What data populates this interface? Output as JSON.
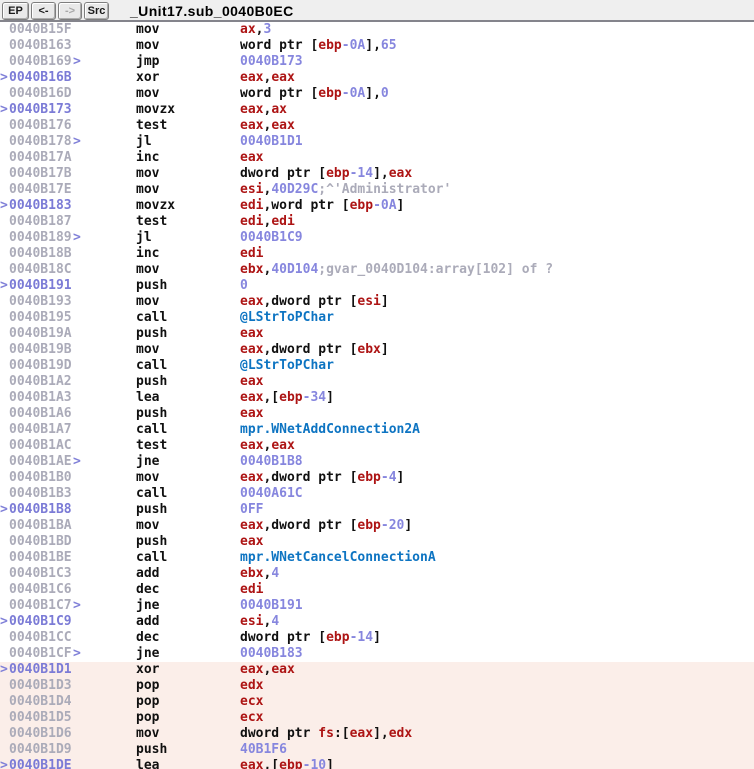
{
  "toolbar": {
    "buttons": [
      {
        "label": "EP",
        "enabled": true
      },
      {
        "label": "<-",
        "enabled": true
      },
      {
        "label": "->",
        "enabled": false
      },
      {
        "label": "Src",
        "enabled": true
      }
    ],
    "title": "_Unit17.sub_0040B0EC"
  },
  "colors": {
    "register": "#AD1414",
    "number": "#8686DE",
    "call_target": "#0D74C2",
    "plain_text": "#101010",
    "address_plain": "#ABABB9",
    "address_jump_target": "#7B7BD6",
    "comment": "#ABABB9",
    "highlight_background": "#FBEEE9",
    "toolbar_background": "#EFEFEF",
    "separator": "#84848C"
  },
  "disassembly": {
    "rows": [
      {
        "pre": "",
        "addr": "0040B15F",
        "addr_type": "plain",
        "suf": "",
        "mnemonic": "mov",
        "highlight": false,
        "operands": [
          {
            "t": "reg",
            "v": "ax"
          },
          {
            "t": "plain",
            "v": ","
          },
          {
            "t": "num",
            "v": "3"
          }
        ]
      },
      {
        "pre": "",
        "addr": "0040B163",
        "addr_type": "plain",
        "suf": "",
        "mnemonic": "mov",
        "highlight": false,
        "operands": [
          {
            "t": "plain",
            "v": "word ptr ["
          },
          {
            "t": "reg",
            "v": "ebp"
          },
          {
            "t": "num",
            "v": "-0A"
          },
          {
            "t": "plain",
            "v": "],"
          },
          {
            "t": "num",
            "v": "65"
          }
        ]
      },
      {
        "pre": "",
        "addr": "0040B169",
        "addr_type": "plain",
        "suf": ">",
        "mnemonic": "jmp",
        "highlight": false,
        "operands": [
          {
            "t": "num",
            "v": "0040B173"
          }
        ]
      },
      {
        "pre": ">",
        "addr": "0040B16B",
        "addr_type": "target",
        "suf": "",
        "mnemonic": "xor",
        "highlight": false,
        "operands": [
          {
            "t": "reg",
            "v": "eax"
          },
          {
            "t": "plain",
            "v": ","
          },
          {
            "t": "reg",
            "v": "eax"
          }
        ]
      },
      {
        "pre": "",
        "addr": "0040B16D",
        "addr_type": "plain",
        "suf": "",
        "mnemonic": "mov",
        "highlight": false,
        "operands": [
          {
            "t": "plain",
            "v": "word ptr ["
          },
          {
            "t": "reg",
            "v": "ebp"
          },
          {
            "t": "num",
            "v": "-0A"
          },
          {
            "t": "plain",
            "v": "],"
          },
          {
            "t": "num",
            "v": "0"
          }
        ]
      },
      {
        "pre": ">",
        "addr": "0040B173",
        "addr_type": "target",
        "suf": "",
        "mnemonic": "movzx",
        "highlight": false,
        "operands": [
          {
            "t": "reg",
            "v": "eax"
          },
          {
            "t": "plain",
            "v": ","
          },
          {
            "t": "reg",
            "v": "ax"
          }
        ]
      },
      {
        "pre": "",
        "addr": "0040B176",
        "addr_type": "plain",
        "suf": "",
        "mnemonic": "test",
        "highlight": false,
        "operands": [
          {
            "t": "reg",
            "v": "eax"
          },
          {
            "t": "plain",
            "v": ","
          },
          {
            "t": "reg",
            "v": "eax"
          }
        ]
      },
      {
        "pre": "",
        "addr": "0040B178",
        "addr_type": "plain",
        "suf": ">",
        "mnemonic": "jl",
        "highlight": false,
        "operands": [
          {
            "t": "num",
            "v": "0040B1D1"
          }
        ]
      },
      {
        "pre": "",
        "addr": "0040B17A",
        "addr_type": "plain",
        "suf": "",
        "mnemonic": "inc",
        "highlight": false,
        "operands": [
          {
            "t": "reg",
            "v": "eax"
          }
        ]
      },
      {
        "pre": "",
        "addr": "0040B17B",
        "addr_type": "plain",
        "suf": "",
        "mnemonic": "mov",
        "highlight": false,
        "operands": [
          {
            "t": "plain",
            "v": "dword ptr ["
          },
          {
            "t": "reg",
            "v": "ebp"
          },
          {
            "t": "num",
            "v": "-14"
          },
          {
            "t": "plain",
            "v": "],"
          },
          {
            "t": "reg",
            "v": "eax"
          }
        ]
      },
      {
        "pre": "",
        "addr": "0040B17E",
        "addr_type": "plain",
        "suf": "",
        "mnemonic": "mov",
        "highlight": false,
        "operands": [
          {
            "t": "reg",
            "v": "esi"
          },
          {
            "t": "plain",
            "v": ","
          },
          {
            "t": "num",
            "v": "40D29C"
          },
          {
            "t": "comment",
            "v": ";^'Administrator'"
          }
        ]
      },
      {
        "pre": ">",
        "addr": "0040B183",
        "addr_type": "target",
        "suf": "",
        "mnemonic": "movzx",
        "highlight": false,
        "operands": [
          {
            "t": "reg",
            "v": "edi"
          },
          {
            "t": "plain",
            "v": ",word ptr ["
          },
          {
            "t": "reg",
            "v": "ebp"
          },
          {
            "t": "num",
            "v": "-0A"
          },
          {
            "t": "plain",
            "v": "]"
          }
        ]
      },
      {
        "pre": "",
        "addr": "0040B187",
        "addr_type": "plain",
        "suf": "",
        "mnemonic": "test",
        "highlight": false,
        "operands": [
          {
            "t": "reg",
            "v": "edi"
          },
          {
            "t": "plain",
            "v": ","
          },
          {
            "t": "reg",
            "v": "edi"
          }
        ]
      },
      {
        "pre": "",
        "addr": "0040B189",
        "addr_type": "plain",
        "suf": ">",
        "mnemonic": "jl",
        "highlight": false,
        "operands": [
          {
            "t": "num",
            "v": "0040B1C9"
          }
        ]
      },
      {
        "pre": "",
        "addr": "0040B18B",
        "addr_type": "plain",
        "suf": "",
        "mnemonic": "inc",
        "highlight": false,
        "operands": [
          {
            "t": "reg",
            "v": "edi"
          }
        ]
      },
      {
        "pre": "",
        "addr": "0040B18C",
        "addr_type": "plain",
        "suf": "",
        "mnemonic": "mov",
        "highlight": false,
        "operands": [
          {
            "t": "reg",
            "v": "ebx"
          },
          {
            "t": "plain",
            "v": ","
          },
          {
            "t": "num",
            "v": "40D104"
          },
          {
            "t": "comment",
            "v": ";gvar_0040D104:array[102] of ?"
          }
        ]
      },
      {
        "pre": ">",
        "addr": "0040B191",
        "addr_type": "target",
        "suf": "",
        "mnemonic": "push",
        "highlight": false,
        "operands": [
          {
            "t": "num",
            "v": "0"
          }
        ]
      },
      {
        "pre": "",
        "addr": "0040B193",
        "addr_type": "plain",
        "suf": "",
        "mnemonic": "mov",
        "highlight": false,
        "operands": [
          {
            "t": "reg",
            "v": "eax"
          },
          {
            "t": "plain",
            "v": ",dword ptr ["
          },
          {
            "t": "reg",
            "v": "esi"
          },
          {
            "t": "plain",
            "v": "]"
          }
        ]
      },
      {
        "pre": "",
        "addr": "0040B195",
        "addr_type": "plain",
        "suf": "",
        "mnemonic": "call",
        "highlight": false,
        "operands": [
          {
            "t": "call",
            "v": "@LStrToPChar"
          }
        ]
      },
      {
        "pre": "",
        "addr": "0040B19A",
        "addr_type": "plain",
        "suf": "",
        "mnemonic": "push",
        "highlight": false,
        "operands": [
          {
            "t": "reg",
            "v": "eax"
          }
        ]
      },
      {
        "pre": "",
        "addr": "0040B19B",
        "addr_type": "plain",
        "suf": "",
        "mnemonic": "mov",
        "highlight": false,
        "operands": [
          {
            "t": "reg",
            "v": "eax"
          },
          {
            "t": "plain",
            "v": ",dword ptr ["
          },
          {
            "t": "reg",
            "v": "ebx"
          },
          {
            "t": "plain",
            "v": "]"
          }
        ]
      },
      {
        "pre": "",
        "addr": "0040B19D",
        "addr_type": "plain",
        "suf": "",
        "mnemonic": "call",
        "highlight": false,
        "operands": [
          {
            "t": "call",
            "v": "@LStrToPChar"
          }
        ]
      },
      {
        "pre": "",
        "addr": "0040B1A2",
        "addr_type": "plain",
        "suf": "",
        "mnemonic": "push",
        "highlight": false,
        "operands": [
          {
            "t": "reg",
            "v": "eax"
          }
        ]
      },
      {
        "pre": "",
        "addr": "0040B1A3",
        "addr_type": "plain",
        "suf": "",
        "mnemonic": "lea",
        "highlight": false,
        "operands": [
          {
            "t": "reg",
            "v": "eax"
          },
          {
            "t": "plain",
            "v": ",["
          },
          {
            "t": "reg",
            "v": "ebp"
          },
          {
            "t": "num",
            "v": "-34"
          },
          {
            "t": "plain",
            "v": "]"
          }
        ]
      },
      {
        "pre": "",
        "addr": "0040B1A6",
        "addr_type": "plain",
        "suf": "",
        "mnemonic": "push",
        "highlight": false,
        "operands": [
          {
            "t": "reg",
            "v": "eax"
          }
        ]
      },
      {
        "pre": "",
        "addr": "0040B1A7",
        "addr_type": "plain",
        "suf": "",
        "mnemonic": "call",
        "highlight": false,
        "operands": [
          {
            "t": "call",
            "v": "mpr.WNetAddConnection2A"
          }
        ]
      },
      {
        "pre": "",
        "addr": "0040B1AC",
        "addr_type": "plain",
        "suf": "",
        "mnemonic": "test",
        "highlight": false,
        "operands": [
          {
            "t": "reg",
            "v": "eax"
          },
          {
            "t": "plain",
            "v": ","
          },
          {
            "t": "reg",
            "v": "eax"
          }
        ]
      },
      {
        "pre": "",
        "addr": "0040B1AE",
        "addr_type": "plain",
        "suf": ">",
        "mnemonic": "jne",
        "highlight": false,
        "operands": [
          {
            "t": "num",
            "v": "0040B1B8"
          }
        ]
      },
      {
        "pre": "",
        "addr": "0040B1B0",
        "addr_type": "plain",
        "suf": "",
        "mnemonic": "mov",
        "highlight": false,
        "operands": [
          {
            "t": "reg",
            "v": "eax"
          },
          {
            "t": "plain",
            "v": ",dword ptr ["
          },
          {
            "t": "reg",
            "v": "ebp"
          },
          {
            "t": "num",
            "v": "-4"
          },
          {
            "t": "plain",
            "v": "]"
          }
        ]
      },
      {
        "pre": "",
        "addr": "0040B1B3",
        "addr_type": "plain",
        "suf": "",
        "mnemonic": "call",
        "highlight": false,
        "operands": [
          {
            "t": "num",
            "v": "0040A61C"
          }
        ]
      },
      {
        "pre": ">",
        "addr": "0040B1B8",
        "addr_type": "target",
        "suf": "",
        "mnemonic": "push",
        "highlight": false,
        "operands": [
          {
            "t": "num",
            "v": "0FF"
          }
        ]
      },
      {
        "pre": "",
        "addr": "0040B1BA",
        "addr_type": "plain",
        "suf": "",
        "mnemonic": "mov",
        "highlight": false,
        "operands": [
          {
            "t": "reg",
            "v": "eax"
          },
          {
            "t": "plain",
            "v": ",dword ptr ["
          },
          {
            "t": "reg",
            "v": "ebp"
          },
          {
            "t": "num",
            "v": "-20"
          },
          {
            "t": "plain",
            "v": "]"
          }
        ]
      },
      {
        "pre": "",
        "addr": "0040B1BD",
        "addr_type": "plain",
        "suf": "",
        "mnemonic": "push",
        "highlight": false,
        "operands": [
          {
            "t": "reg",
            "v": "eax"
          }
        ]
      },
      {
        "pre": "",
        "addr": "0040B1BE",
        "addr_type": "plain",
        "suf": "",
        "mnemonic": "call",
        "highlight": false,
        "operands": [
          {
            "t": "call",
            "v": "mpr.WNetCancelConnectionA"
          }
        ]
      },
      {
        "pre": "",
        "addr": "0040B1C3",
        "addr_type": "plain",
        "suf": "",
        "mnemonic": "add",
        "highlight": false,
        "operands": [
          {
            "t": "reg",
            "v": "ebx"
          },
          {
            "t": "plain",
            "v": ","
          },
          {
            "t": "num",
            "v": "4"
          }
        ]
      },
      {
        "pre": "",
        "addr": "0040B1C6",
        "addr_type": "plain",
        "suf": "",
        "mnemonic": "dec",
        "highlight": false,
        "operands": [
          {
            "t": "reg",
            "v": "edi"
          }
        ]
      },
      {
        "pre": "",
        "addr": "0040B1C7",
        "addr_type": "plain",
        "suf": ">",
        "mnemonic": "jne",
        "highlight": false,
        "operands": [
          {
            "t": "num",
            "v": "0040B191"
          }
        ]
      },
      {
        "pre": ">",
        "addr": "0040B1C9",
        "addr_type": "target",
        "suf": "",
        "mnemonic": "add",
        "highlight": false,
        "operands": [
          {
            "t": "reg",
            "v": "esi"
          },
          {
            "t": "plain",
            "v": ","
          },
          {
            "t": "num",
            "v": "4"
          }
        ]
      },
      {
        "pre": "",
        "addr": "0040B1CC",
        "addr_type": "plain",
        "suf": "",
        "mnemonic": "dec",
        "highlight": false,
        "operands": [
          {
            "t": "plain",
            "v": "dword ptr ["
          },
          {
            "t": "reg",
            "v": "ebp"
          },
          {
            "t": "num",
            "v": "-14"
          },
          {
            "t": "plain",
            "v": "]"
          }
        ]
      },
      {
        "pre": "",
        "addr": "0040B1CF",
        "addr_type": "plain",
        "suf": ">",
        "mnemonic": "jne",
        "highlight": false,
        "operands": [
          {
            "t": "num",
            "v": "0040B183"
          }
        ]
      },
      {
        "pre": ">",
        "addr": "0040B1D1",
        "addr_type": "target",
        "suf": "",
        "mnemonic": "xor",
        "highlight": true,
        "operands": [
          {
            "t": "reg",
            "v": "eax"
          },
          {
            "t": "plain",
            "v": ","
          },
          {
            "t": "reg",
            "v": "eax"
          }
        ]
      },
      {
        "pre": "",
        "addr": "0040B1D3",
        "addr_type": "plain",
        "suf": "",
        "mnemonic": "pop",
        "highlight": true,
        "operands": [
          {
            "t": "reg",
            "v": "edx"
          }
        ]
      },
      {
        "pre": "",
        "addr": "0040B1D4",
        "addr_type": "plain",
        "suf": "",
        "mnemonic": "pop",
        "highlight": true,
        "operands": [
          {
            "t": "reg",
            "v": "ecx"
          }
        ]
      },
      {
        "pre": "",
        "addr": "0040B1D5",
        "addr_type": "plain",
        "suf": "",
        "mnemonic": "pop",
        "highlight": true,
        "operands": [
          {
            "t": "reg",
            "v": "ecx"
          }
        ]
      },
      {
        "pre": "",
        "addr": "0040B1D6",
        "addr_type": "plain",
        "suf": "",
        "mnemonic": "mov",
        "highlight": true,
        "operands": [
          {
            "t": "plain",
            "v": "dword ptr "
          },
          {
            "t": "reg",
            "v": "fs"
          },
          {
            "t": "plain",
            "v": ":["
          },
          {
            "t": "reg",
            "v": "eax"
          },
          {
            "t": "plain",
            "v": "],"
          },
          {
            "t": "reg",
            "v": "edx"
          }
        ]
      },
      {
        "pre": "",
        "addr": "0040B1D9",
        "addr_type": "plain",
        "suf": "",
        "mnemonic": "push",
        "highlight": true,
        "operands": [
          {
            "t": "num",
            "v": "40B1F6"
          }
        ]
      },
      {
        "pre": ">",
        "addr": "0040B1DE",
        "addr_type": "target",
        "suf": "",
        "mnemonic": "lea",
        "highlight": true,
        "operands": [
          {
            "t": "reg",
            "v": "eax"
          },
          {
            "t": "plain",
            "v": ",["
          },
          {
            "t": "reg",
            "v": "ebp"
          },
          {
            "t": "num",
            "v": "-10"
          },
          {
            "t": "plain",
            "v": "]"
          }
        ]
      }
    ]
  }
}
